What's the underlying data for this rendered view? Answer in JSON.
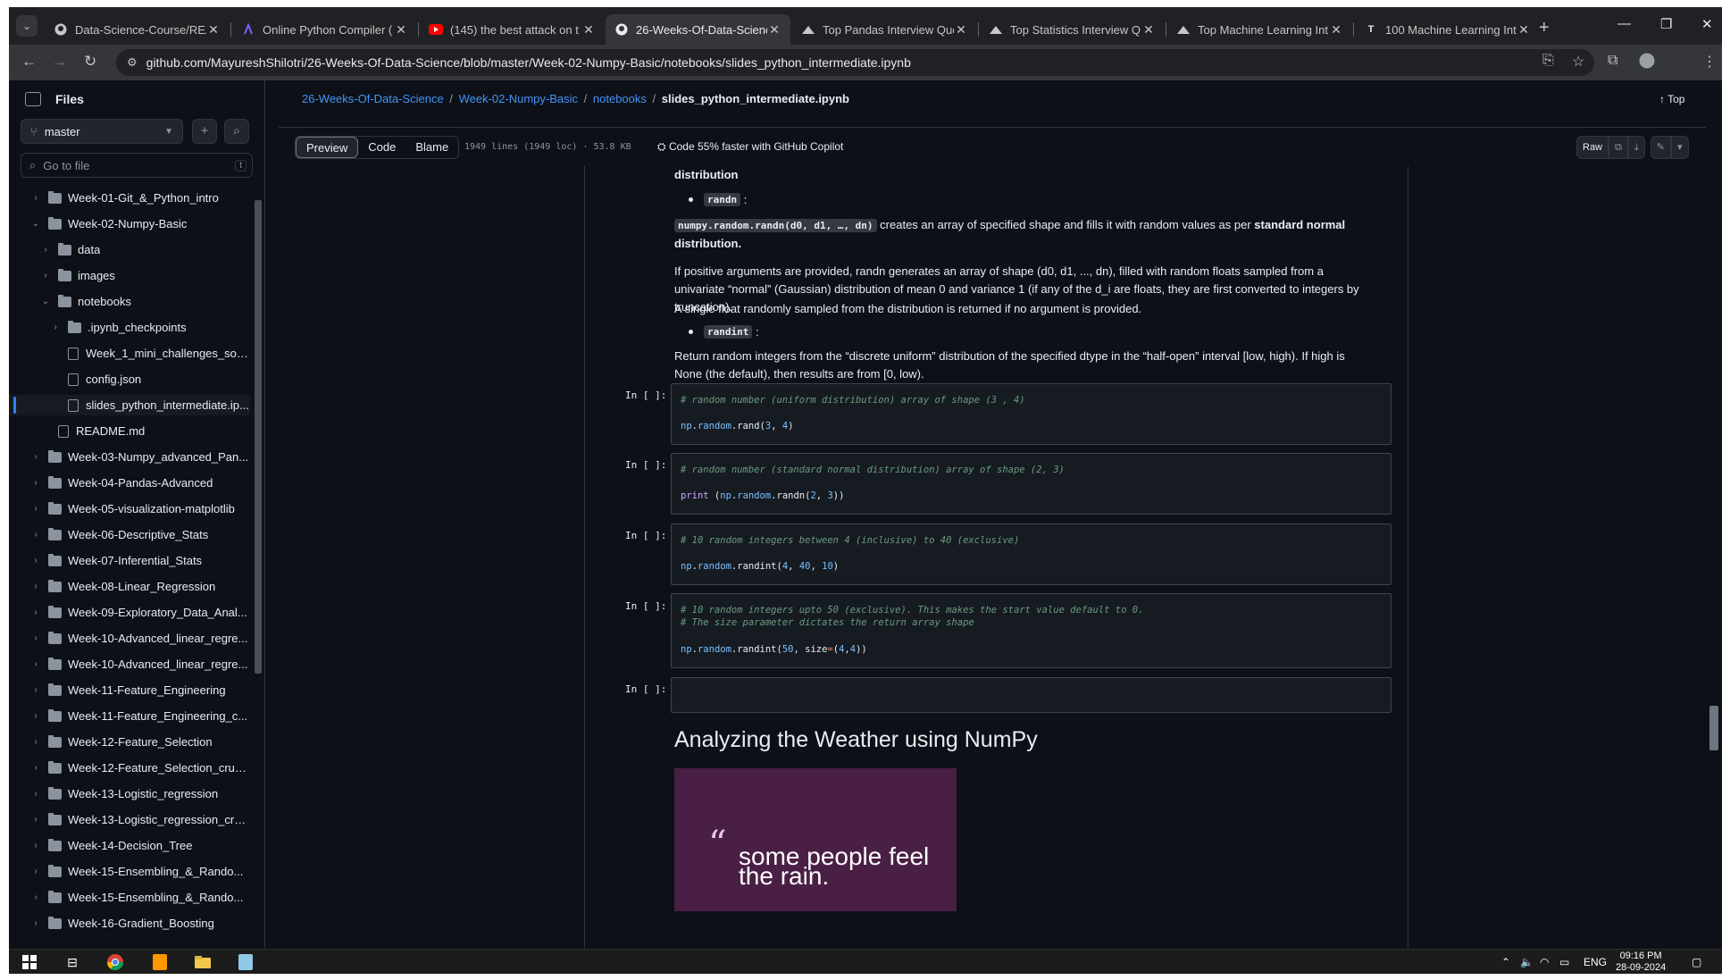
{
  "tabs": [
    {
      "title": "Data-Science-Course/REA",
      "icon": "github-icon",
      "active": false
    },
    {
      "title": "Online Python Compiler (",
      "icon": "compiler-icon",
      "active": false
    },
    {
      "title": "(145) the best attack on t",
      "icon": "youtube-icon",
      "active": false
    },
    {
      "title": "26-Weeks-Of-Data-Scienc",
      "icon": "github-icon",
      "active": true
    },
    {
      "title": "Top Pandas Interview Que",
      "icon": "mountain-icon",
      "active": false
    },
    {
      "title": "Top Statistics Interview Q",
      "icon": "mountain-icon",
      "active": false
    },
    {
      "title": "Top Machine Learning Int",
      "icon": "mountain-icon",
      "active": false
    },
    {
      "title": "100 Machine Learning Int",
      "icon": "t-logo-icon",
      "active": false
    }
  ],
  "address": {
    "url": "github.com/MayureshShilotri/26-Weeks-Of-Data-Science/blob/master/Week-02-Numpy-Basic/notebooks/slides_python_intermediate.ipynb"
  },
  "sidebar": {
    "title": "Files",
    "branch": "master",
    "goto_placeholder": "Go to file",
    "goto_shortcut": "t",
    "items": [
      {
        "label": "Week-01-Git_&_Python_intro",
        "type": "folder",
        "depth": 0,
        "expanded": false
      },
      {
        "label": "Week-02-Numpy-Basic",
        "type": "folder",
        "depth": 0,
        "expanded": true
      },
      {
        "label": "data",
        "type": "folder",
        "depth": 1,
        "expanded": false
      },
      {
        "label": "images",
        "type": "folder",
        "depth": 1,
        "expanded": false
      },
      {
        "label": "notebooks",
        "type": "folder",
        "depth": 1,
        "expanded": true
      },
      {
        "label": ".ipynb_checkpoints",
        "type": "folder",
        "depth": 2,
        "expanded": false
      },
      {
        "label": "Week_1_mini_challenges_solu...",
        "type": "file",
        "depth": 2
      },
      {
        "label": "config.json",
        "type": "file",
        "depth": 2
      },
      {
        "label": "slides_python_intermediate.ip...",
        "type": "file",
        "depth": 2,
        "selected": true
      },
      {
        "label": "README.md",
        "type": "file",
        "depth": 1
      },
      {
        "label": "Week-03-Numpy_advanced_Pan...",
        "type": "folder",
        "depth": 0,
        "expanded": false
      },
      {
        "label": "Week-04-Pandas-Advanced",
        "type": "folder",
        "depth": 0,
        "expanded": false
      },
      {
        "label": "Week-05-visualization-matplotlib",
        "type": "folder",
        "depth": 0,
        "expanded": false
      },
      {
        "label": "Week-06-Descriptive_Stats",
        "type": "folder",
        "depth": 0,
        "expanded": false
      },
      {
        "label": "Week-07-Inferential_Stats",
        "type": "folder",
        "depth": 0,
        "expanded": false
      },
      {
        "label": "Week-08-Linear_Regression",
        "type": "folder",
        "depth": 0,
        "expanded": false
      },
      {
        "label": "Week-09-Exploratory_Data_Anal...",
        "type": "folder",
        "depth": 0,
        "expanded": false
      },
      {
        "label": "Week-10-Advanced_linear_regre...",
        "type": "folder",
        "depth": 0,
        "expanded": false
      },
      {
        "label": "Week-10-Advanced_linear_regre...",
        "type": "folder",
        "depth": 0,
        "expanded": false
      },
      {
        "label": "Week-11-Feature_Engineering",
        "type": "folder",
        "depth": 0,
        "expanded": false
      },
      {
        "label": "Week-11-Feature_Engineering_c...",
        "type": "folder",
        "depth": 0,
        "expanded": false
      },
      {
        "label": "Week-12-Feature_Selection",
        "type": "folder",
        "depth": 0,
        "expanded": false
      },
      {
        "label": "Week-12-Feature_Selection_cruc...",
        "type": "folder",
        "depth": 0,
        "expanded": false
      },
      {
        "label": "Week-13-Logistic_regression",
        "type": "folder",
        "depth": 0,
        "expanded": false
      },
      {
        "label": "Week-13-Logistic_regression_cru...",
        "type": "folder",
        "depth": 0,
        "expanded": false
      },
      {
        "label": "Week-14-Decision_Tree",
        "type": "folder",
        "depth": 0,
        "expanded": false
      },
      {
        "label": "Week-15-Ensembling_&_Rando...",
        "type": "folder",
        "depth": 0,
        "expanded": false
      },
      {
        "label": "Week-15-Ensembling_&_Rando...",
        "type": "folder",
        "depth": 0,
        "expanded": false
      },
      {
        "label": "Week-16-Gradient_Boosting",
        "type": "folder",
        "depth": 0,
        "expanded": false
      }
    ]
  },
  "breadcrumb": {
    "repo": "26-Weeks-Of-Data-Science",
    "folder": "Week-02-Numpy-Basic",
    "subfolder": "notebooks",
    "file": "slides_python_intermediate.ipynb",
    "sep": "/"
  },
  "top_link": "Top",
  "viewer": {
    "tabs": [
      "Preview",
      "Code",
      "Blame"
    ],
    "active_tab": "Preview",
    "meta": "1949 lines (1949 loc) · 53.8 KB",
    "copilot": "Code 55% faster with GitHub Copilot",
    "raw": "Raw"
  },
  "notebook": {
    "partial_top": "distribution",
    "randn_bullet": "randn",
    "randn_sig": "numpy.random.randn(d0, d1, …, dn)",
    "randn_desc": "creates an array of specified shape and fills it with random values as per",
    "randn_bold": "standard normal distribution.",
    "randn_para": "If positive arguments are provided, randn generates an array of shape (d0, d1, ..., dn), filled with random floats sampled from a univariate “normal” (Gaussian) distribution of mean 0 and variance 1 (if any of the d_i are floats, they are first converted to integers by truncation).",
    "randn_para2": "A single float randomly sampled from the distribution is returned if no argument is provided.",
    "randint_bullet": "randint",
    "randint_para": "Return random integers from the “discrete uniform” distribution of the specified dtype in the “half-open” interval [low, high). If high is None (the default), then results are from [0, low).",
    "prompt": "In [ ]:",
    "cells": [
      {
        "comment": "# random number (uniform distribution) array of shape (3 , 4)",
        "code": "np.random.rand(3, 4)"
      },
      {
        "comment": "# random number (standard normal distribution) array of shape (2, 3)",
        "code": "print (np.random.randn(2, 3))"
      },
      {
        "comment": "# 10 random integers between 4 (inclusive) to 40 (exclusive)",
        "code": "np.random.randint(4, 40, 10)"
      },
      {
        "comment": "# 10 random integers upto 50 (exclusive). This makes the start value default to 0.",
        "comment2": "# The size parameter dictates the return array shape",
        "code": "np.random.randint(50, size=(4,4))"
      }
    ],
    "heading": "Analyzing the Weather using NumPy",
    "poster_text": "some people feel the rain."
  },
  "taskbar": {
    "lang": "ENG",
    "time": "09:16 PM",
    "date": "28-09-2024"
  }
}
